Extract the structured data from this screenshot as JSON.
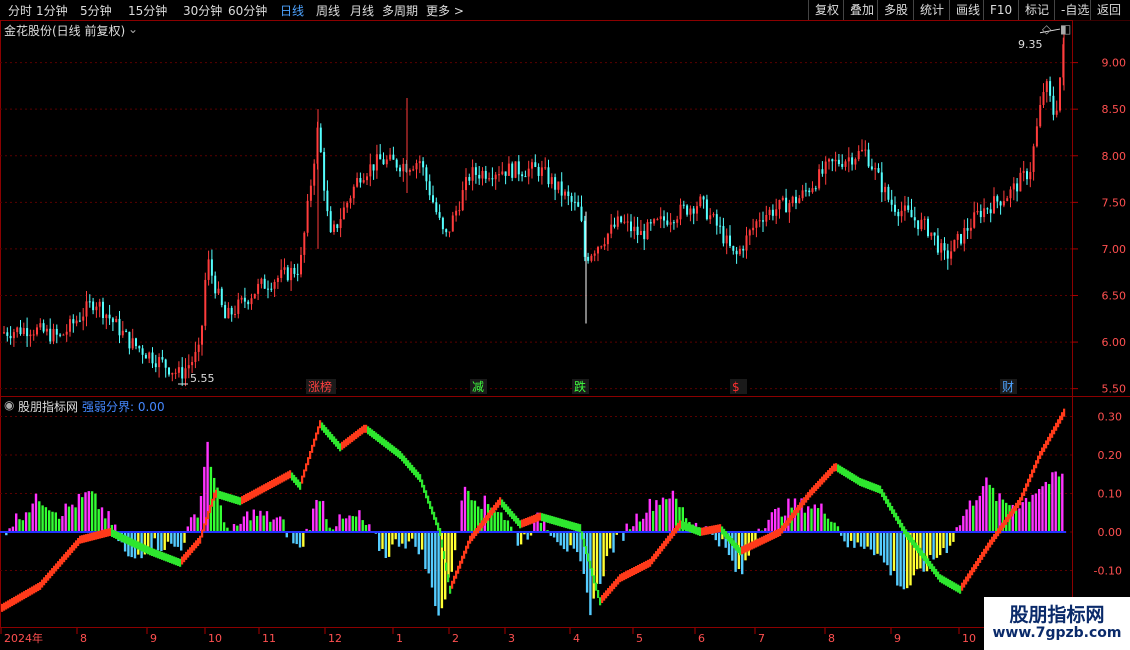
{
  "toolbar": {
    "periods": [
      "分时",
      "1分钟",
      "5分钟",
      "15分钟",
      "30分钟",
      "60分钟",
      "日线",
      "周线",
      "月线",
      "多周期",
      "更多"
    ],
    "active_period": "日线",
    "more_arrow": ">",
    "right_buttons": [
      "复权",
      "叠加",
      "多股",
      "统计",
      "画线",
      "F10",
      "标记",
      "-自选",
      "返回"
    ]
  },
  "main_chart": {
    "title": "金花股份(日线 前复权)",
    "high_label": "9.35",
    "low_label": "5.55",
    "y_ticks": [
      "9.00",
      "8.50",
      "8.00",
      "7.50",
      "7.00",
      "6.50",
      "6.00",
      "5.50"
    ],
    "event_tags": [
      {
        "text": "涨榜",
        "color": "#ff4040"
      },
      {
        "text": "减",
        "color": "#40ff40"
      },
      {
        "text": "跌",
        "color": "#40ff40"
      },
      {
        "text": "$",
        "color": "#ff3030"
      },
      {
        "text": "财",
        "color": "#4da3ff"
      }
    ]
  },
  "indicator": {
    "title": "股朋指标网",
    "subtitle": "强弱分界: 0.00",
    "y_ticks": [
      "0.30",
      "0.20",
      "0.10",
      "0.00",
      "-0.10"
    ]
  },
  "x_axis": [
    "2024年",
    "8",
    "9",
    "10",
    "11",
    "12",
    "1",
    "2",
    "3",
    "4",
    "5",
    "6",
    "7",
    "8",
    "9",
    "10"
  ],
  "watermark": {
    "line1": "股朋指标网",
    "line2": "www.7gpzb.com"
  },
  "colors": {
    "up": "#ff3c3c",
    "down": "#54ffff",
    "frame": "#8b0000",
    "pos_magenta": "#ff33ff",
    "pos_green": "#33ff33",
    "neg_cyan": "#55ccff",
    "neg_yellow": "#ffff33",
    "ribbon_red": "#ff3a1a",
    "ribbon_green": "#2ee62e",
    "zero_line": "#2233ff"
  }
}
